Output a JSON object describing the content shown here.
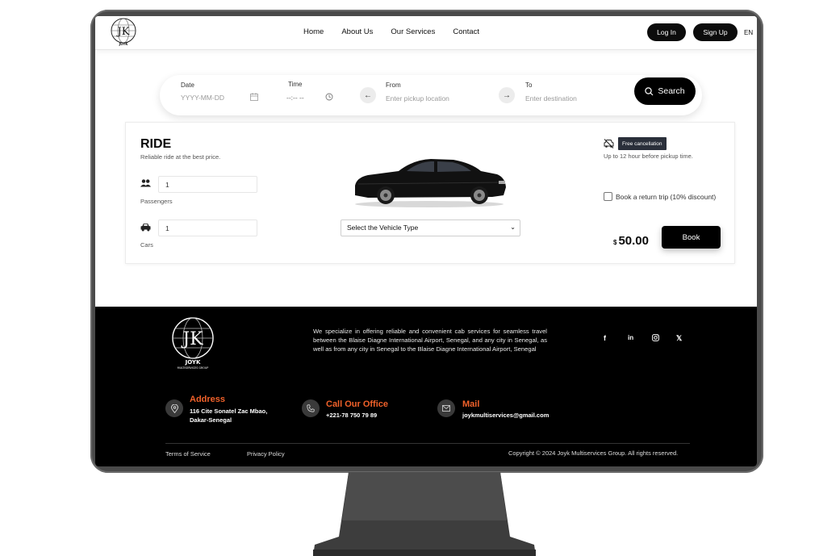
{
  "nav": {
    "links": [
      "Home",
      "About Us",
      "Our Services",
      "Contact"
    ],
    "login_label": "Log In",
    "signup_label": "Sign Up",
    "language": "EN"
  },
  "search": {
    "date_label": "Date",
    "date_placeholder": "YYYY-MM-DD",
    "time_label": "Time",
    "time_placeholder": "--:-- --",
    "from_label": "From",
    "from_placeholder": "Enter pickup location",
    "to_label": "To",
    "to_placeholder": "Enter destination",
    "search_label": "Search"
  },
  "ride": {
    "title": "RIDE",
    "subtitle": "Reliable ride at the best price.",
    "passengers_value": "1",
    "passengers_label": "Passengers",
    "cars_value": "1",
    "cars_label": "Cars",
    "vehicle_select": "Select the Vehicle Type",
    "cancel_badge": "Free cancellation",
    "cancel_note": "Up to 12 hour before pickup time.",
    "return_label": "Book a return trip (10% discount)",
    "currency": "$",
    "price": "50.00",
    "book_label": "Book"
  },
  "footer": {
    "about": "We specialize in offering reliable and convenient cab services for seamless travel between the Blaise Diagne International Airport, Senegal, and any city in Senegal, as well as from any city in Senegal to the Blaise Diagne International Airport, Senegal",
    "address_title": "Address",
    "address_line1": "116 Cite Sonatel Zac Mbao,",
    "address_line2": "Dakar-Senegal",
    "phone_title": "Call Our Office",
    "phone": "+221-78 750 79 89",
    "mail_title": "Mail",
    "mail": "joykmultiservices@gmail.com",
    "terms": "Terms of Service",
    "privacy": "Privacy Policy",
    "copyright": "Copyright © 2024 Joyk Multiservices Group. All rights reserved.",
    "social": [
      "facebook-icon",
      "linkedin-icon",
      "instagram-icon",
      "x-icon"
    ]
  },
  "logo": {
    "name": "JOYK",
    "tagline": "MULTISERVICES GROUP"
  },
  "colors": {
    "accent": "#f0612a",
    "dark": "#000000",
    "badge": "#2a2f3a"
  }
}
